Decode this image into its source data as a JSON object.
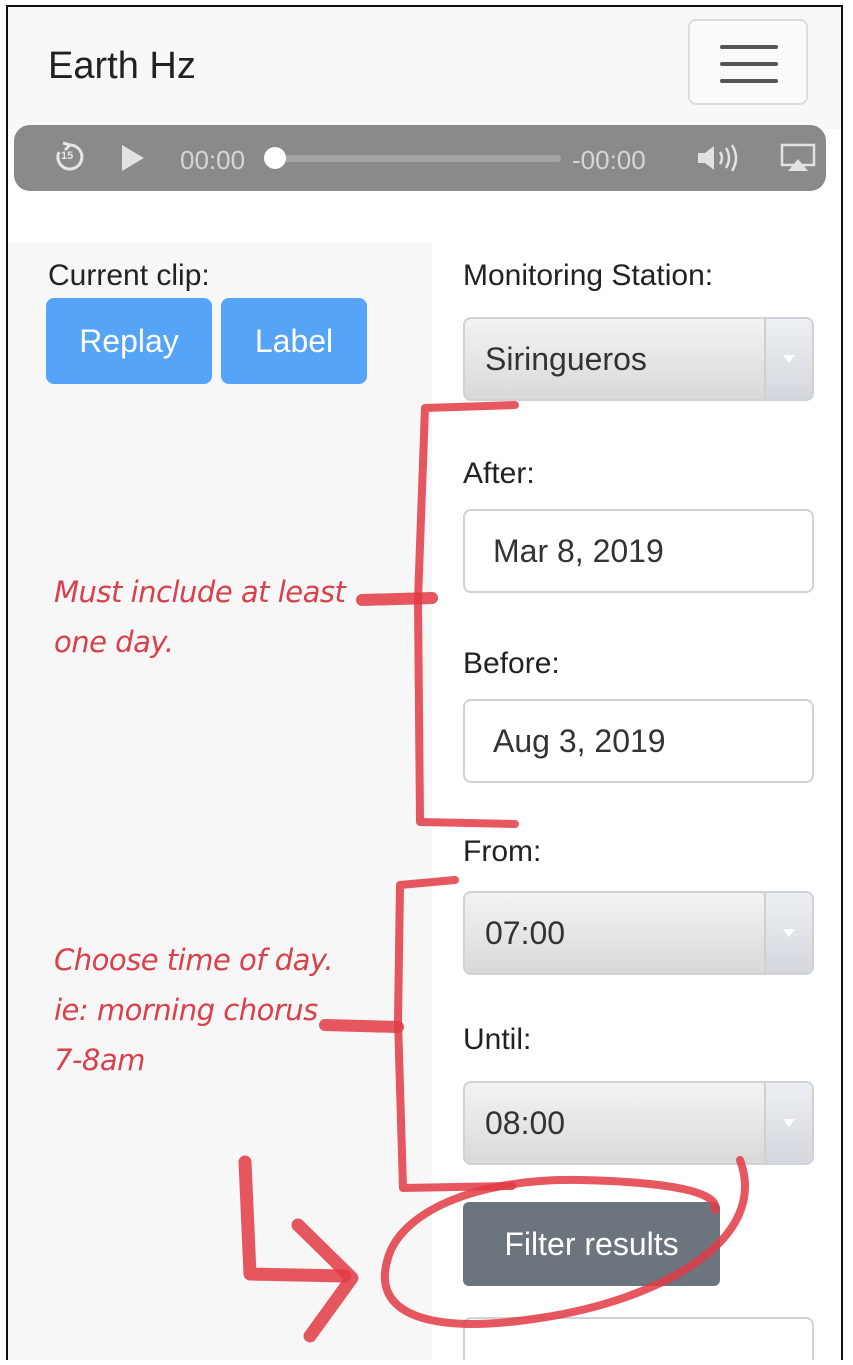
{
  "app": {
    "title": "Earth Hz"
  },
  "navbar": {
    "menu_icon": "hamburger-icon"
  },
  "audio_player": {
    "skip_back_label": "15",
    "current_time": "00:00",
    "remaining_time": "-00:00",
    "progress": 0,
    "icons": [
      "skip-back-15-icon",
      "play-icon",
      "volume-icon",
      "airplay-icon"
    ]
  },
  "current_clip": {
    "label": "Current clip:",
    "replay_label": "Replay",
    "label_button": "Label"
  },
  "filters": {
    "station_label": "Monitoring Station:",
    "station_value": "Siringueros",
    "after_label": "After:",
    "after_value": "Mar 8, 2019",
    "before_label": "Before:",
    "before_value": "Aug 3, 2019",
    "from_label": "From:",
    "from_value": "07:00",
    "until_label": "Until:",
    "until_value": "08:00",
    "filter_button": "Filter results"
  },
  "annotations": {
    "date_note_line1": "Must include at least",
    "date_note_line2": "one day.",
    "time_note_line1": "Choose time of day.",
    "time_note_line2": "ie: morning chorus",
    "time_note_line3": "7-8am"
  },
  "colors": {
    "primary": "#56a4f7",
    "filter_button": "#6c757d",
    "annotation": "#e23a44",
    "player_bg": "#8a8a8a"
  }
}
